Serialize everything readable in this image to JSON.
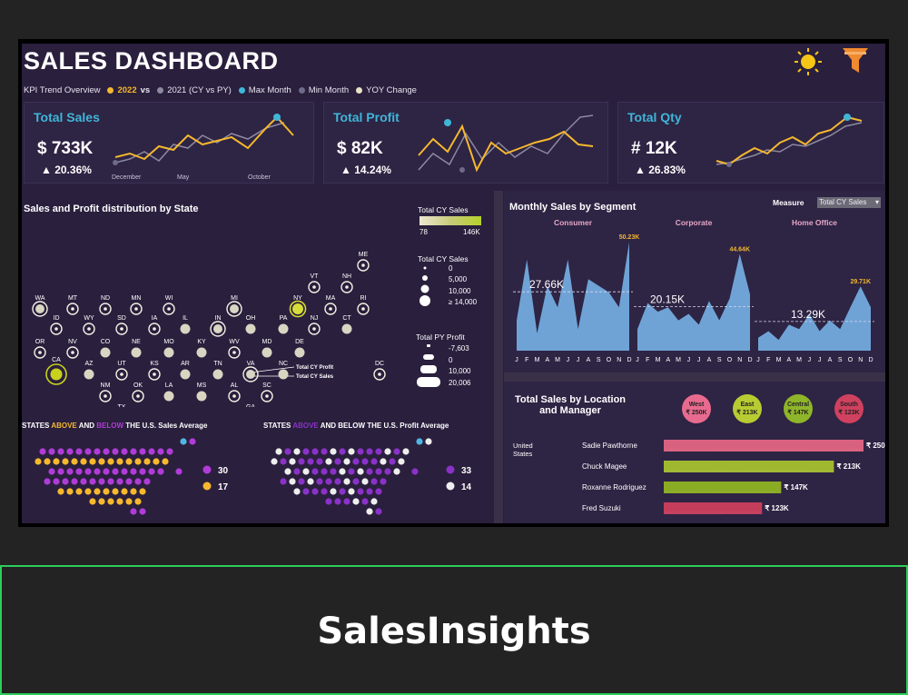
{
  "header": {
    "title": "SALES DASHBOARD"
  },
  "kpi_legend": {
    "label": "KPI Trend Overview",
    "cy": "2022",
    "vs": "vs",
    "py": "2021 (CY vs PY)",
    "max": "Max Month",
    "min": "Min Month",
    "yoy": "YOY Change"
  },
  "kpis": [
    {
      "title": "Total Sales",
      "value": "$ 733K",
      "change": "▲ 20.36%",
      "ticks": [
        "December",
        "May",
        "October"
      ]
    },
    {
      "title": "Total Profit",
      "value": "$ 82K",
      "change": "▲ 14.24%"
    },
    {
      "title": "Total Qty",
      "value": "# 12K",
      "change": "▲ 26.83%"
    }
  ],
  "map_section": {
    "title": "Sales and Profit distribution by State",
    "legend_cy_title": "Total CY Sales",
    "legend_cy_min": "78",
    "legend_cy_max": "146K",
    "legend_size_title": "Total CY Sales",
    "legend_size_values": [
      "0",
      "5,000",
      "10,000",
      "≥ 14,000"
    ],
    "legend_py_title": "Total PY Profit",
    "legend_py_values": [
      "-7,603",
      "0",
      "10,000",
      "20,006"
    ],
    "anno_profit": "Total CY Profit",
    "anno_sales": "Total CY Sales"
  },
  "states": [
    "ME",
    "VT",
    "NH",
    "WA",
    "MT",
    "ND",
    "MN",
    "WI",
    "MI",
    "NY",
    "MA",
    "RI",
    "ID",
    "WY",
    "SD",
    "IA",
    "IL",
    "IN",
    "OH",
    "PA",
    "NJ",
    "CT",
    "OR",
    "NV",
    "CO",
    "NE",
    "MO",
    "KY",
    "WV",
    "MD",
    "DE",
    "CA",
    "AZ",
    "UT",
    "KS",
    "AR",
    "TN",
    "VA",
    "NC",
    "DC",
    "NM",
    "OK",
    "LA",
    "MS",
    "AL",
    "SC",
    "TX",
    "GA",
    "FL"
  ],
  "sales_avg": {
    "title_pre": "STATES",
    "above": "ABOVE",
    "mid": "AND",
    "below": "BELOW",
    "title_post": "THE U.S. Sales Average",
    "count_below": "30",
    "count_above": "17"
  },
  "profit_avg": {
    "title_pre": "STATES",
    "above": "ABOVE",
    "title_post": "AND BELOW THE U.S. Profit Average",
    "count_below": "33",
    "count_above": "14"
  },
  "segments": {
    "title": "Monthly Sales by Segment",
    "measure_label": "Measure",
    "measure_value": "Total CY Sales",
    "months": [
      "J",
      "F",
      "M",
      "A",
      "M",
      "J",
      "J",
      "A",
      "S",
      "O",
      "N",
      "D"
    ]
  },
  "chart_data": [
    {
      "type": "area",
      "title": "Monthly Sales by Segment",
      "categories": [
        "J",
        "F",
        "M",
        "A",
        "M",
        "J",
        "J",
        "A",
        "S",
        "O",
        "N",
        "D"
      ],
      "series": [
        {
          "name": "Consumer",
          "avg_label": "27.66K",
          "max_label": "50.23K",
          "values": [
            14,
            42,
            8,
            30,
            20,
            42,
            10,
            33,
            30,
            27,
            20,
            50.23
          ]
        },
        {
          "name": "Corporate",
          "avg_label": "20.15K",
          "max_label": "44.64K",
          "values": [
            10,
            22,
            18,
            20,
            14,
            17,
            12,
            23,
            14,
            24,
            44.64,
            26
          ]
        },
        {
          "name": "Home Office",
          "avg_label": "13.29K",
          "max_label": "29.71K",
          "values": [
            6,
            9,
            5,
            12,
            10,
            17,
            9,
            14,
            10,
            20,
            29.71,
            20
          ]
        }
      ]
    },
    {
      "type": "bar",
      "title": "Total Sales by Location and Manager",
      "location": "United States",
      "categories": [
        "Sadie Pawthorne",
        "Chuck Magee",
        "Roxanne Rodriguez",
        "Fred Suzuki"
      ],
      "values": [
        250,
        213,
        147,
        123
      ],
      "labels": [
        "₹ 250K",
        "₹ 213K",
        "₹ 147K",
        "₹ 123K"
      ]
    }
  ],
  "regions": [
    {
      "name": "West",
      "value": "₹ 250K",
      "color": "#e86b8f"
    },
    {
      "name": "East",
      "value": "₹ 213K",
      "color": "#b8cc32"
    },
    {
      "name": "Central",
      "value": "₹ 147K",
      "color": "#8fb52a"
    },
    {
      "name": "South",
      "value": "₹ 123K",
      "color": "#d0415f"
    }
  ],
  "bar_colors": [
    "#d8617f",
    "#9fb830",
    "#8aab24",
    "#c43e5c"
  ],
  "colors": {
    "accent": "#3fb6d8",
    "cy": "#f5b82e",
    "py": "#8d8aa0",
    "bg": "#2a1f3d",
    "area": "#6fa3d6"
  },
  "banner": {
    "text": "SalesInsights"
  }
}
